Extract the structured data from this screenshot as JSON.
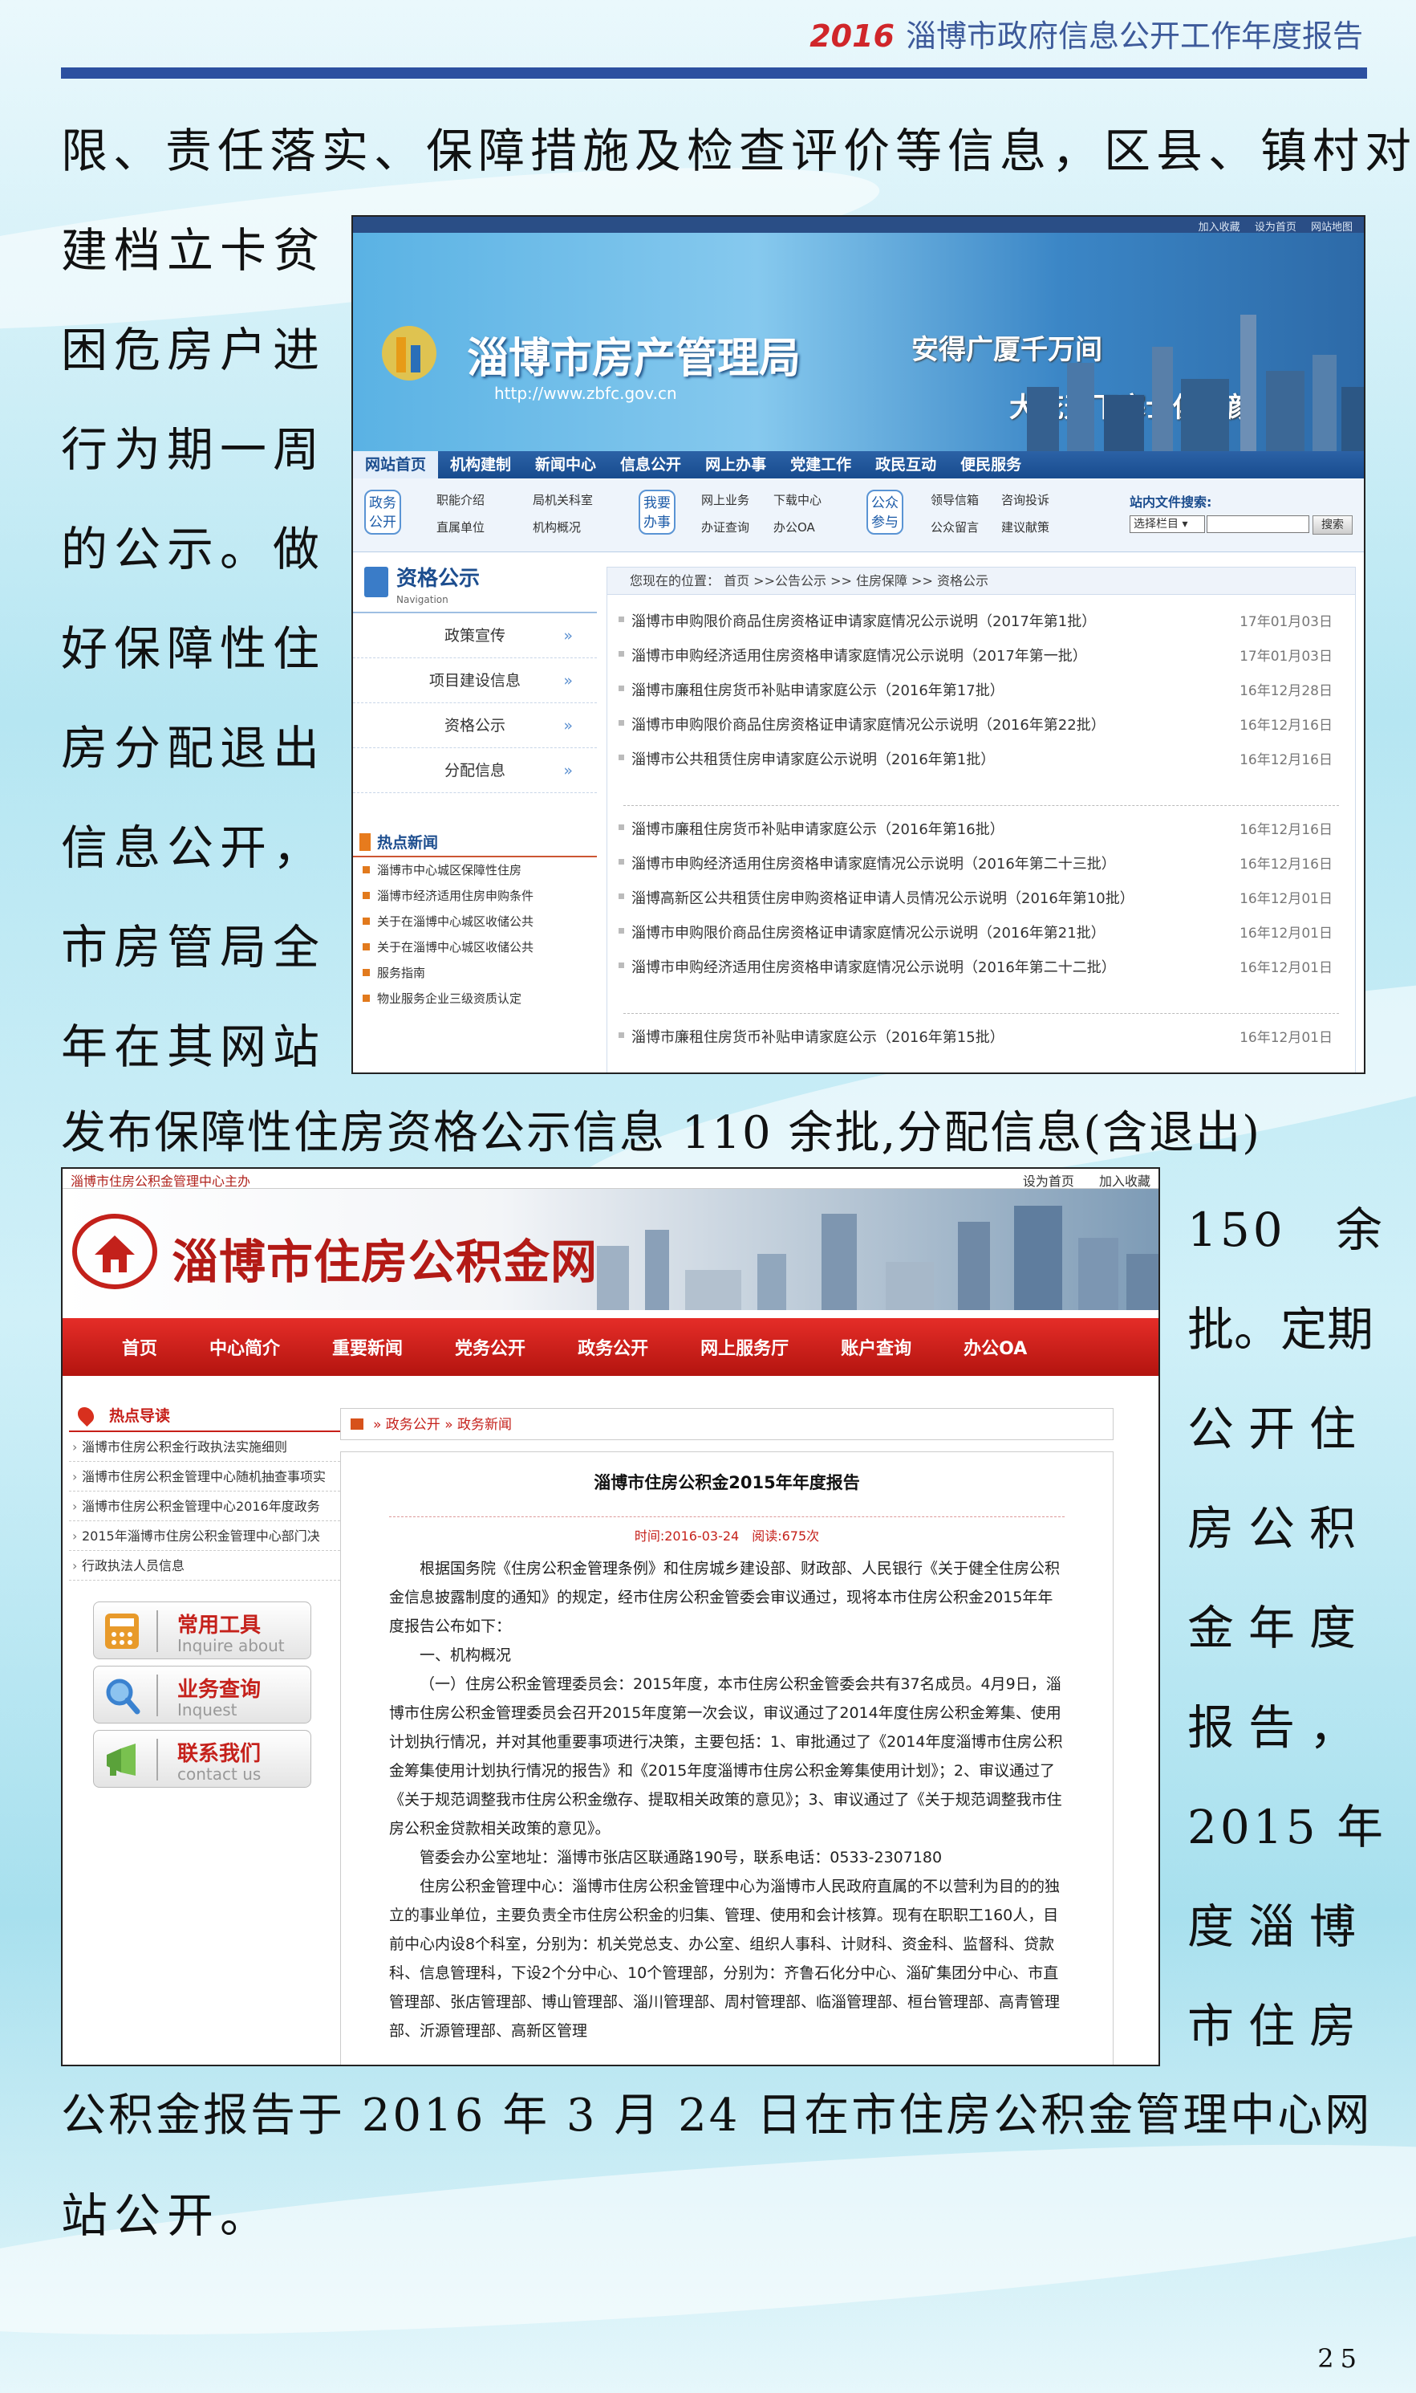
{
  "header": {
    "year": "2016",
    "title": "淄博市政府信息公开工作年度报告"
  },
  "paragraph": [
    {
      "text": "限、责任落实、保障措施及检查评价等信息，区县、镇村对"
    },
    {
      "text": "建档立卡贫"
    },
    {
      "text": "困危房户进"
    },
    {
      "text": "行为期一周"
    },
    {
      "text": "的公示。做"
    },
    {
      "text": "好保障性住"
    },
    {
      "text": "房分配退出"
    },
    {
      "text": "信息公开，"
    },
    {
      "text": "市房管局全"
    },
    {
      "text": "年在其网站"
    },
    {
      "text": "发布保障性住房资格公示信息 110 余批,分配信息(含退出)"
    },
    {
      "text": "150　余"
    },
    {
      "text": "批。定期"
    },
    {
      "text": "公开住"
    },
    {
      "text": "房公积"
    },
    {
      "text": "金年度"
    },
    {
      "text": "报告，"
    },
    {
      "text": "2015 年"
    },
    {
      "text": "度淄博"
    },
    {
      "text": "市住房"
    },
    {
      "text": "公积金报告于 2016 年 3 月 24 日在市住房公积金管理中心网"
    },
    {
      "text": "站公开。"
    }
  ],
  "page_number": "25",
  "screenshot1": {
    "top_links": [
      "加入收藏",
      "设为首页",
      "网站地图"
    ],
    "site_name": "淄博市房产管理局",
    "url": "http://www.zbfc.gov.cn",
    "slogan1": "安得广厦千万间",
    "slogan2": "大庇天下寒士俱欢颜",
    "nav": [
      "网站首页",
      "机构建制",
      "新闻中心",
      "信息公开",
      "网上办事",
      "党建工作",
      "政民互动",
      "便民服务"
    ],
    "badges": [
      "政务公开",
      "我要办事",
      "公众参与"
    ],
    "sublinks": [
      "职能介绍",
      "局机关科室",
      "直属单位",
      "机构概况",
      "网上业务",
      "下载中心",
      "办证查询",
      "办公OA",
      "领导信箱",
      "咨询投诉",
      "公众留言",
      "建议献策"
    ],
    "search_label": "站内文件搜索:",
    "search_select": "选择栏目 ▾",
    "search_button": "搜索",
    "section_title": "资格公示",
    "section_sub": "Navigation",
    "menu": [
      "政策宣传",
      "项目建设信息",
      "资格公示",
      "分配信息"
    ],
    "hot_title": "热点新闻",
    "hot_news": [
      "淄博市中心城区保障性住房",
      "淄博市经济适用住房申购条件",
      "关于在淄博中心城区收储公共",
      "关于在淄博中心城区收储公共",
      "服务指南",
      "物业服务企业三级资质认定"
    ],
    "breadcrumb": "您现在的位置： 首页 >>公告公示 >> 住房保障 >> 资格公示",
    "rows_a": [
      {
        "title": "淄博市申购限价商品住房资格证申请家庭情况公示说明（2017年第1批）",
        "date": "17年01月03日"
      },
      {
        "title": "淄博市申购经济适用住房资格申请家庭情况公示说明（2017年第一批）",
        "date": "17年01月03日"
      },
      {
        "title": "淄博市廉租住房货币补贴申请家庭公示（2016年第17批）",
        "date": "16年12月28日"
      },
      {
        "title": "淄博市申购限价商品住房资格证申请家庭情况公示说明（2016年第22批）",
        "date": "16年12月16日"
      },
      {
        "title": "淄博市公共租赁住房申请家庭公示说明（2016年第1批）",
        "date": "16年12月16日"
      }
    ],
    "rows_b": [
      {
        "title": "淄博市廉租住房货币补贴申请家庭公示（2016年第16批）",
        "date": "16年12月16日"
      },
      {
        "title": "淄博市申购经济适用住房资格申请家庭情况公示说明（2016年第二十三批）",
        "date": "16年12月16日"
      },
      {
        "title": "淄博高新区公共租赁住房申购资格证申请人员情况公示说明（2016年第10批）",
        "date": "16年12月01日"
      },
      {
        "title": "淄博市申购限价商品住房资格证申请家庭情况公示说明（2016年第21批）",
        "date": "16年12月01日"
      },
      {
        "title": "淄博市申购经济适用住房资格申请家庭情况公示说明（2016年第二十二批）",
        "date": "16年12月01日"
      }
    ],
    "rows_c": [
      {
        "title": "淄博市廉租住房货币补贴申请家庭公示（2016年第15批）",
        "date": "16年12月01日"
      }
    ]
  },
  "screenshot2": {
    "top_left": "淄博市住房公积金管理中心主办",
    "top_links": [
      "设为首页",
      "加入收藏"
    ],
    "site_name": "淄博市住房公积金网",
    "nav": [
      "首页",
      "中心简介",
      "重要新闻",
      "党务公开",
      "政务公开",
      "网上服务厅",
      "账户查询",
      "办公OA"
    ],
    "hot_title": "热点导读",
    "hot_list": [
      "淄博市住房公积金行政执法实施细则",
      "淄博市住房公积金管理中心随机抽查事项实",
      "淄博市住房公积金管理中心2016年度政务",
      "2015年淄博市住房公积金管理中心部门决",
      "行政执法人员信息"
    ],
    "services": [
      {
        "title": "常用工具",
        "en": "Inquire about",
        "color": "#e89a2a"
      },
      {
        "title": "业务查询",
        "en": "Inquest",
        "color": "#3a82d0"
      },
      {
        "title": "联系我们",
        "en": "contact us",
        "color": "#5aa23a"
      }
    ],
    "breadcrumb": "» 政务公开 » 政务新闻",
    "article_title": "淄博市住房公积金2015年年度报告",
    "article_meta": "时间:2016-03-24　阅读:675次",
    "article_body": [
      "根据国务院《住房公积金管理条例》和住房城乡建设部、财政部、人民银行《关于健全住房公积金信息披露制度的通知》的规定，经市住房公积金管委会审议通过，现将本市住房公积金2015年年度报告公布如下：",
      "一、机构概况",
      "（一）住房公积金管理委员会：2015年度，本市住房公积金管委会共有37名成员。4月9日，淄博市住房公积金管理委员会召开2015年度第一次会议，审议通过了2014年度住房公积金筹集、使用计划执行情况，并对其他重要事项进行决策，主要包括：1、审批通过了《2014年度淄博市住房公积金筹集使用计划执行情况的报告》和《2015年度淄博市住房公积金筹集使用计划》；2、审议通过了《关于规范调整我市住房公积金缴存、提取相关政策的意见》；3、审议通过了《关于规范调整我市住房公积金贷款相关政策的意见》。",
      "管委会办公室地址：淄博市张店区联通路190号，联系电话：0533-2307180",
      "住房公积金管理中心：淄博市住房公积金管理中心为淄博市人民政府直属的不以营利为目的的独立的事业单位，主要负责全市住房公积金的归集、管理、使用和会计核算。现有在职职工160人，目前中心内设8个科室，分别为：机关党总支、办公室、组织人事科、计财科、资金科、监督科、贷款科、信息管理科，下设2个分中心、10个管理部，分别为：齐鲁石化分中心、淄矿集团分中心、市直管理部、张店管理部、博山管理部、淄川管理部、周村管理部、临淄管理部、桓台管理部、高青管理部、沂源管理部、高新区管理"
    ]
  }
}
